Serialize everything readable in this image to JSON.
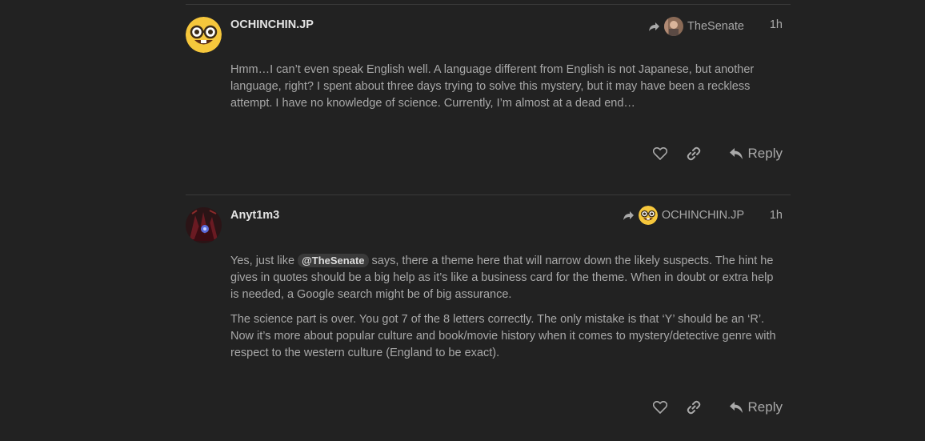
{
  "posts": [
    {
      "username": "OCHINCHIN.JP",
      "reply_to": "TheSenate",
      "time": "1h",
      "paragraphs": [
        "Hmm…I can’t even speak English well. A language different from English is not Japanese, but another language, right? I spent about three days trying to solve this mystery, but it may have been a reckless attempt. I have no knowledge of science. Currently, I’m almost at a dead end…"
      ],
      "reply_label": "Reply"
    },
    {
      "username": "Anyt1m3",
      "reply_to": "OCHINCHIN.JP",
      "time": "1h",
      "p1_before": "Yes, just like ",
      "mention": "@TheSenate",
      "p1_after": " says, there a theme here that will narrow down the likely suspects. The hint he gives in quotes should be a big help as it’s like a business card for the theme. When in doubt or extra help is needed, a Google search might be of big assurance.",
      "p2": "The science part is over. You got 7 of the 8 letters correctly. The only mistake is that ‘Y’ should be an ‘R’. Now it’s more about popular culture and book/movie history when it comes to mystery/detective genre with respect to the western culture (England to be exact).",
      "reply_label": "Reply"
    }
  ],
  "icons": {
    "like": "heart-icon",
    "link": "link-icon",
    "reply": "reply-icon",
    "reply_to": "share-arrow-icon"
  },
  "colors": {
    "background": "#222222",
    "text": "#a8a8a8",
    "username": "#e4e4e4",
    "mention_bg": "#3a3a3a"
  }
}
